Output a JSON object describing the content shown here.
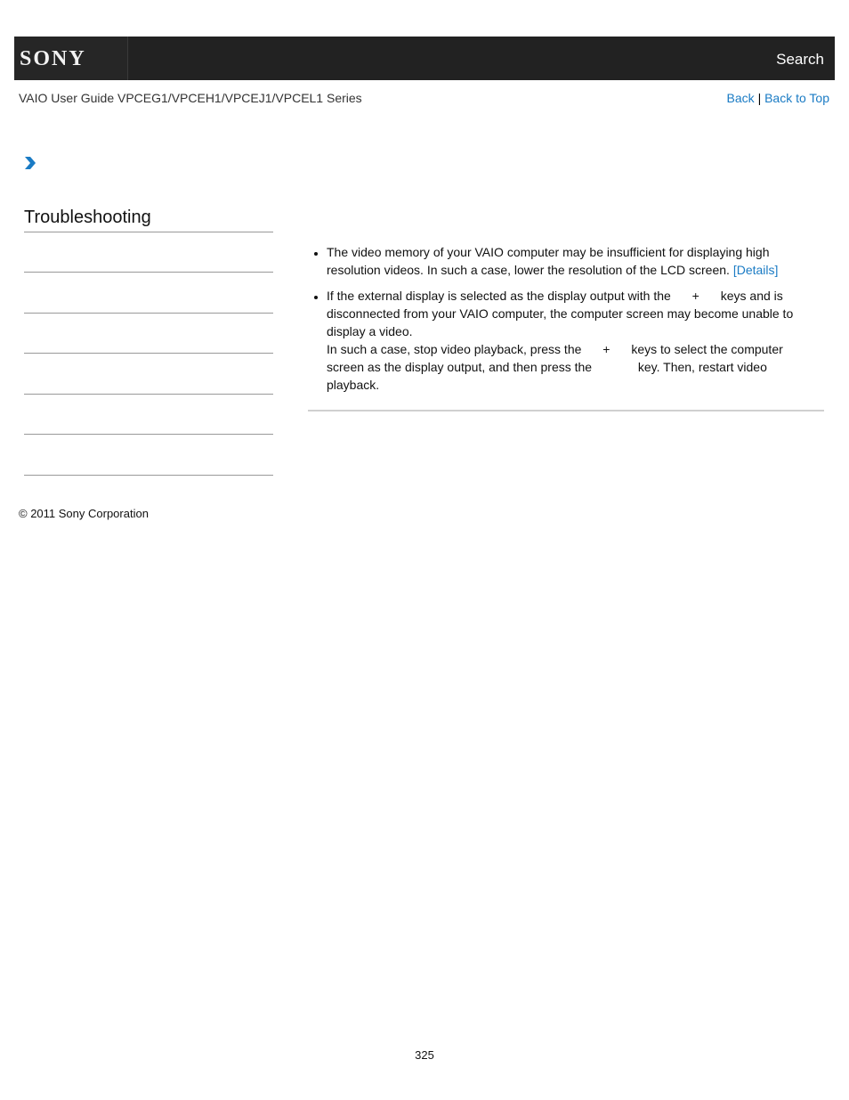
{
  "header": {
    "logo_text": "SONY",
    "search_label": "Search"
  },
  "guide": {
    "title": "VAIO User Guide VPCEG1/VPCEH1/VPCEJ1/VPCEL1 Series",
    "back_label": "Back",
    "separator": "|",
    "back_to_top_label": "Back to Top"
  },
  "breadcrumb": {
    "icon": "chevron-right-icon"
  },
  "sidebar": {
    "title": "Troubleshooting"
  },
  "content": {
    "bullet1_text": "The video memory of your VAIO computer may be insufficient for displaying high resolution videos. In such a case, lower the resolution of the LCD screen. ",
    "bullet1_link": "[Details]",
    "bullet2_p1a": "If the external display is selected as the display output with the ",
    "bullet2_plus1": "+",
    "bullet2_p1b": " keys and is disconnected from your VAIO computer, the computer screen may become unable to display a video.",
    "bullet2_p2a": "In such a case, stop video playback, press the ",
    "bullet2_plus2": "+",
    "bullet2_p2b": " keys to select the computer screen as the display output, and then press the ",
    "bullet2_p2c": " key. Then, restart video playback."
  },
  "footer": {
    "copyright": "© 2011 Sony Corporation",
    "page_number": "325"
  },
  "colors": {
    "header_bg": "#222222",
    "link": "#1a7bc4",
    "chevron": "#1a7bc4"
  }
}
